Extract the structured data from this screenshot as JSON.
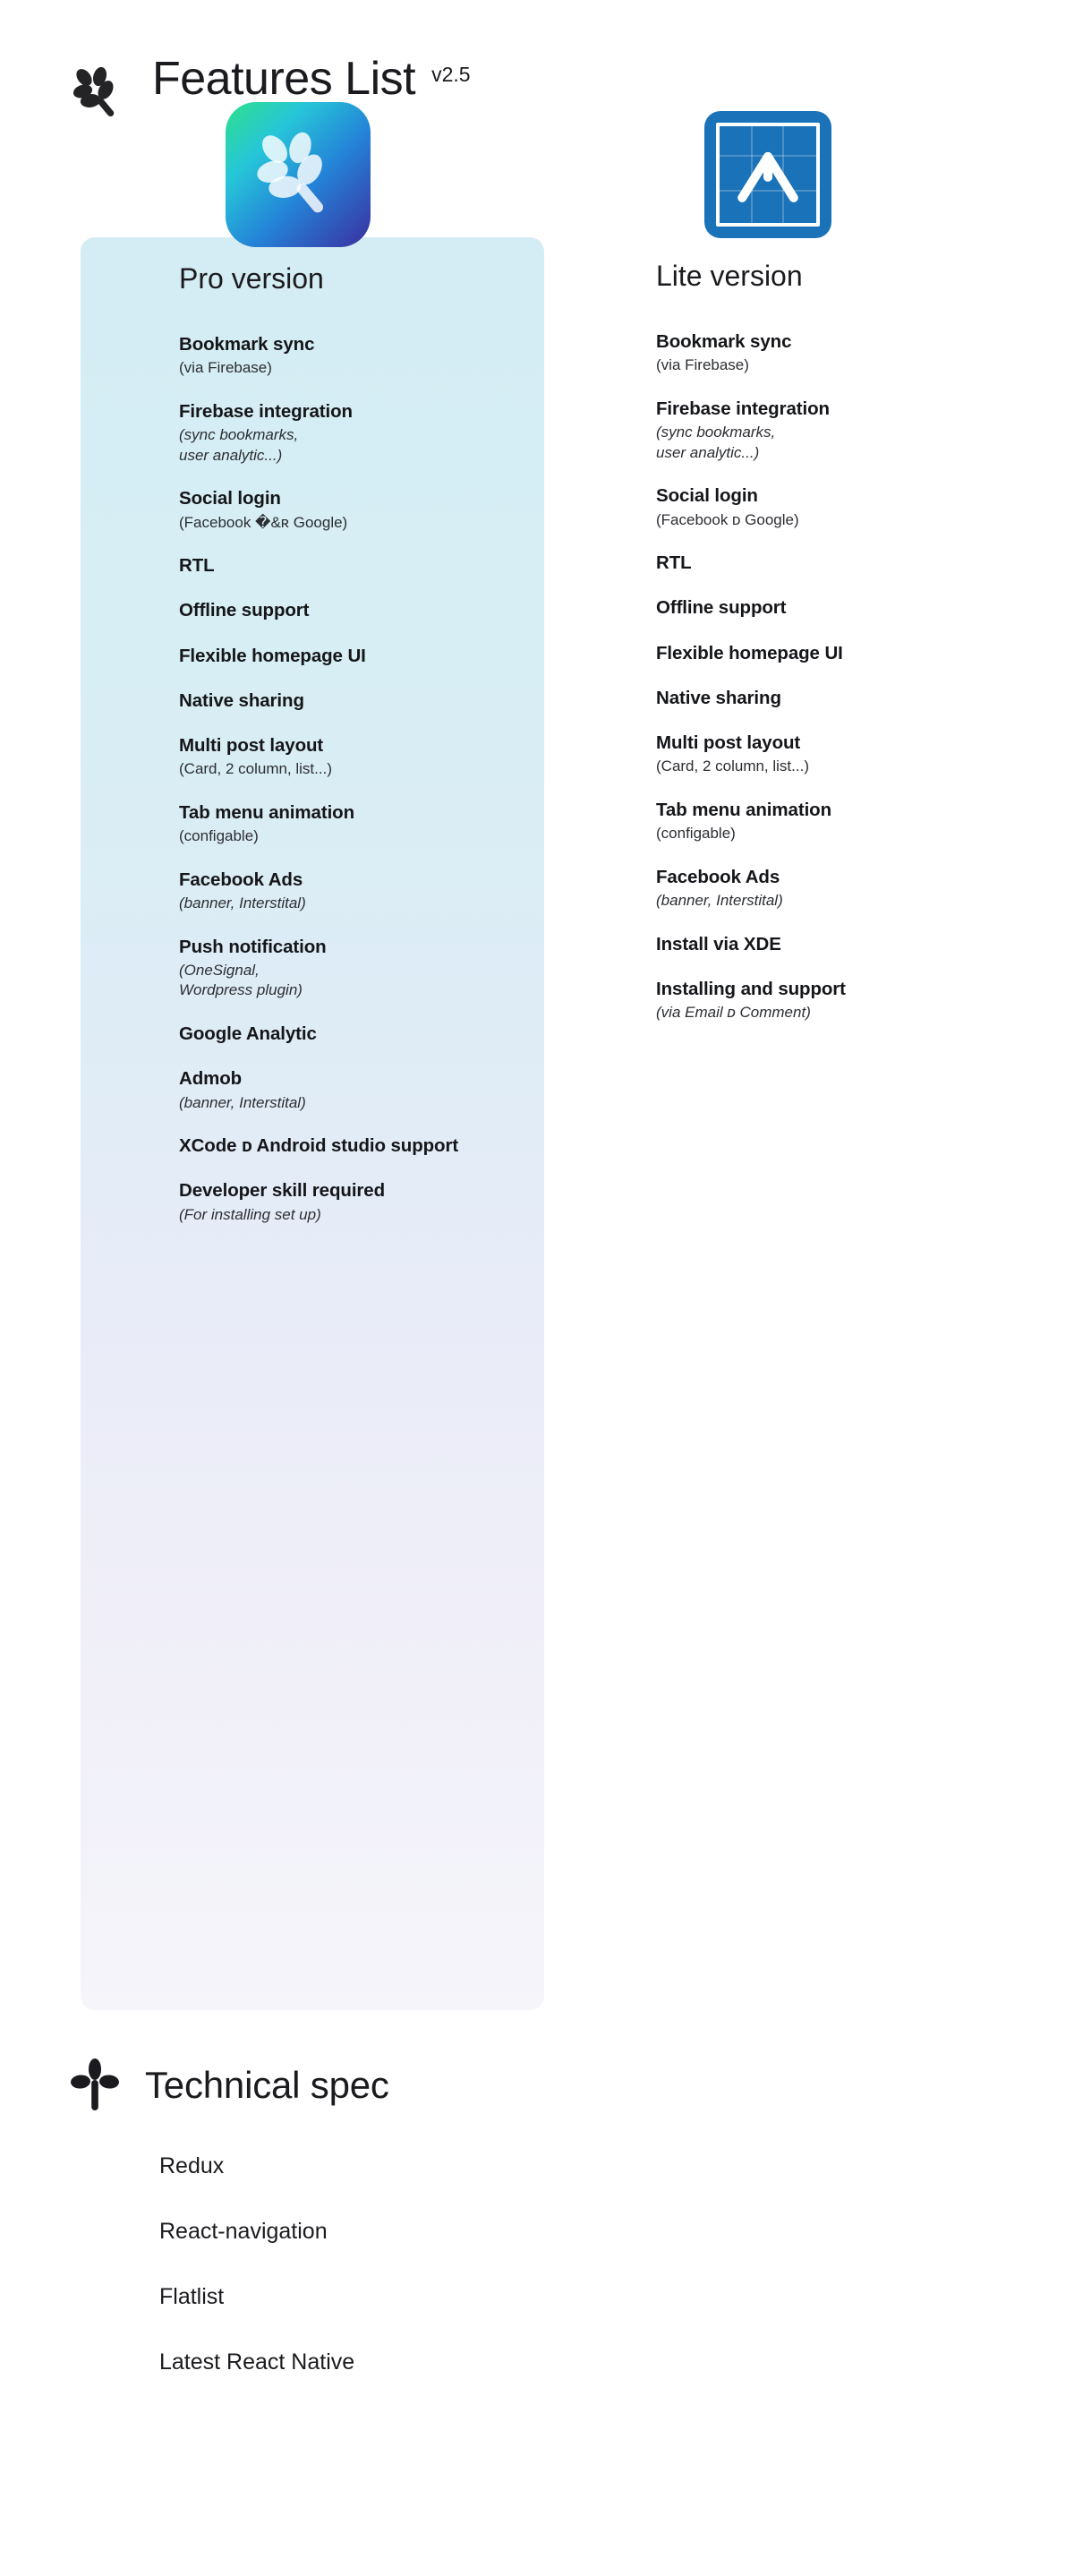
{
  "header": {
    "icon": "branch-leaf-icon",
    "title": "Features List",
    "version": "v2.5"
  },
  "columns": {
    "pro": {
      "icon": "pro-app-icon",
      "heading": "Pro version",
      "features": [
        {
          "name": "Bookmark sync",
          "note": "(via Firebase)",
          "italic": false
        },
        {
          "name": "Firebase integration",
          "note": "(sync bookmarks,\nuser analytic...)",
          "italic": true
        },
        {
          "name": "Social login",
          "note": "(Facebook �&ʀ Google)",
          "italic": false
        },
        {
          "name": "RTL",
          "note": "",
          "italic": false
        },
        {
          "name": "Offline support",
          "note": "",
          "italic": false
        },
        {
          "name": "Flexible homepage UI",
          "note": "",
          "italic": false
        },
        {
          "name": "Native sharing",
          "note": "",
          "italic": false
        },
        {
          "name": "Multi post layout",
          "note": "(Card, 2 column, list...)",
          "italic": false
        },
        {
          "name": "Tab menu animation",
          "note": "(configable)",
          "italic": false
        },
        {
          "name": "Facebook Ads",
          "note": "(banner, Interstital)",
          "italic": true
        },
        {
          "name": "Push notification",
          "note": "(OneSignal,\nWordpress plugin)",
          "italic": true
        },
        {
          "name": "Google Analytic",
          "note": "",
          "italic": false
        },
        {
          "name": "Admob",
          "note": "(banner, Interstital)",
          "italic": true
        },
        {
          "name": "XCode ᴅ Android studio support",
          "note": "",
          "italic": false
        },
        {
          "name": "Developer skill required",
          "note": "(For installing set up)",
          "italic": true
        }
      ]
    },
    "lite": {
      "icon": "lite-app-icon",
      "heading": "Lite version",
      "features": [
        {
          "name": "Bookmark sync",
          "note": "(via Firebase)",
          "italic": false
        },
        {
          "name": "Firebase integration",
          "note": "(sync bookmarks,\nuser analytic...)",
          "italic": true
        },
        {
          "name": "Social login",
          "note": "(Facebook ᴅ Google)",
          "italic": false
        },
        {
          "name": "RTL",
          "note": "",
          "italic": false
        },
        {
          "name": "Offline support",
          "note": "",
          "italic": false
        },
        {
          "name": "Flexible homepage UI",
          "note": "",
          "italic": false
        },
        {
          "name": "Native sharing",
          "note": "",
          "italic": false
        },
        {
          "name": "Multi post layout",
          "note": "(Card, 2 column, list...)",
          "italic": false
        },
        {
          "name": "Tab menu animation",
          "note": "(configable)",
          "italic": false
        },
        {
          "name": "Facebook Ads",
          "note": "(banner, Interstital)",
          "italic": true
        },
        {
          "name": "Install via XDE",
          "note": "",
          "italic": false
        },
        {
          "name": "Installing and support",
          "note": "(via Email ᴅ Comment)",
          "italic": true
        }
      ]
    }
  },
  "tech_spec": {
    "icon": "sprout-icon",
    "title": "Technical spec",
    "items": [
      "Redux",
      "React-navigation",
      "Flatlist",
      "Latest React Native"
    ]
  },
  "colors": {
    "panel_top": "#d4ecf3",
    "panel_bottom": "#f5f5fa",
    "pro_icon_gradient_start": "#2fe08a",
    "pro_icon_gradient_end": "#3b2fa0",
    "lite_icon_blue": "#1a72b8",
    "text": "#1b1b1f",
    "page_background": "#ffffff"
  }
}
